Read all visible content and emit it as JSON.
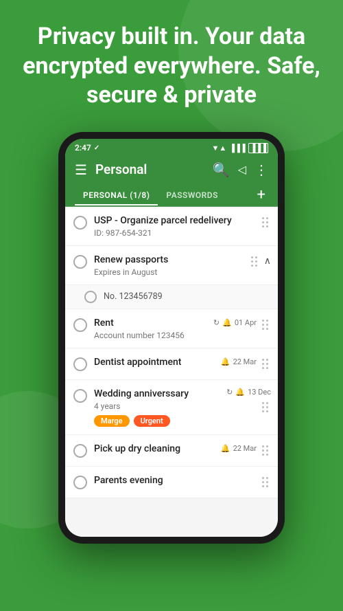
{
  "hero": {
    "text": "Privacy built in. Your data encrypted everywhere. Safe, secure & private"
  },
  "status_bar": {
    "time": "2:47",
    "check_icon": "✓",
    "signal_icon": "▲",
    "wifi_icon": "▼",
    "battery_icon": "▐"
  },
  "app_bar": {
    "menu_icon": "☰",
    "title": "Personal",
    "search_icon": "🔍",
    "share_icon": "◁",
    "more_icon": "⋮"
  },
  "tabs": {
    "personal_label": "PERSONAL (1/8)",
    "passwords_label": "PASSWORDS",
    "add_icon": "+"
  },
  "tasks": [
    {
      "id": "task-1",
      "title": "USP - Organize parcel redelivery",
      "subtitle": "ID: 987-654-321",
      "date": null,
      "recur": null,
      "tags": []
    },
    {
      "id": "task-2",
      "title": "Renew passports",
      "subtitle": "Expires in August",
      "expanded": true,
      "sub_items": [
        {
          "text": "No. 123456789"
        }
      ],
      "date": null,
      "recur": null,
      "tags": []
    },
    {
      "id": "task-3",
      "title": "Rent",
      "subtitle": "Account number 123456",
      "date": "01 Apr",
      "recur": "↻",
      "bell": "🔔",
      "tags": []
    },
    {
      "id": "task-4",
      "title": "Dentist appointment",
      "subtitle": null,
      "date": "22 Mar",
      "bell": "🔔",
      "recur": null,
      "tags": []
    },
    {
      "id": "task-5",
      "title": "Wedding anniverssary",
      "subtitle": "4 years",
      "date": "13 Dec",
      "recur": "↻",
      "bell": "🔔",
      "tags": [
        "Marge",
        "Urgent"
      ]
    },
    {
      "id": "task-6",
      "title": "Pick up dry cleaning",
      "subtitle": null,
      "date": "22 Mar",
      "bell": "🔔",
      "recur": null,
      "tags": []
    },
    {
      "id": "task-7",
      "title": "Parents evening",
      "subtitle": null,
      "date": null,
      "recur": null,
      "tags": []
    }
  ],
  "colors": {
    "green": "#388e3c",
    "orange": "#ff9800",
    "red_orange": "#ff5722"
  }
}
